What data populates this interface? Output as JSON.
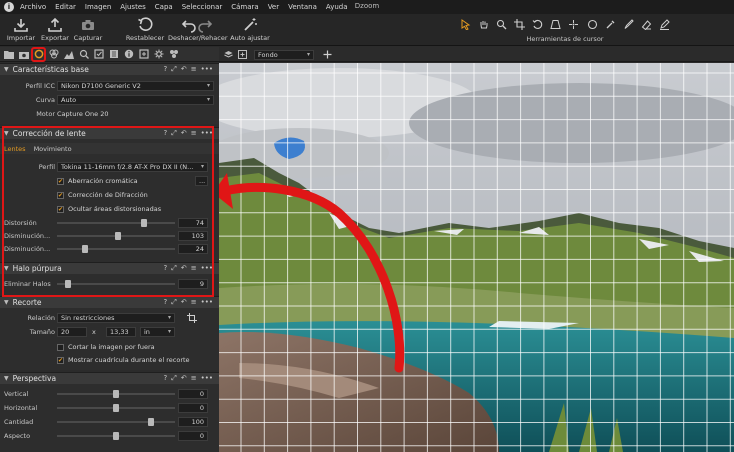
{
  "window": {
    "title": "Dzoom"
  },
  "menu": [
    "Archivo",
    "Editar",
    "Imagen",
    "Ajustes",
    "Capa",
    "Seleccionar",
    "Cámara",
    "Ver",
    "Ventana",
    "Ayuda"
  ],
  "toolbar": {
    "import": "Importar",
    "export": "Exportar",
    "capture": "Capturar",
    "reset": "Restablecer",
    "undo_redo": "Deshacer/Rehacer",
    "auto_adjust": "Auto ajustar",
    "cursor_tools": "Herramientas de cursor"
  },
  "viewer": {
    "layer": "Fondo"
  },
  "base_characteristics": {
    "title": "Características base",
    "icc_label": "Perfil ICC",
    "icc_value": "Nikon D7100 Generic V2",
    "curve_label": "Curva",
    "curve_value": "Auto",
    "engine_label": "Motor",
    "engine_value": "Capture One 20"
  },
  "lens_correction": {
    "title": "Corrección de lente",
    "tab_lenses": "Lentes",
    "tab_movement": "Movimiento",
    "profile_label": "Perfil",
    "profile_value": "Tokina 11-16mm f/2.8 AT-X Pro DX II (N...",
    "chromatic": "Aberración cromática",
    "chromatic_more": "...",
    "diffraction": "Corrección de Difracción",
    "hide_distorted": "Ocultar áreas distorsionadas",
    "distortion_label": "Distorsión",
    "distortion_value": "74",
    "distortion_level": 0.74,
    "falloff_label": "Disminución...",
    "falloff_value": "103",
    "falloff_level": 0.515,
    "sharpness_label": "Disminución...",
    "sharpness_value": "24",
    "sharpness_level": 0.24
  },
  "purple_fringe": {
    "title": "Halo púrpura",
    "remove_label": "Eliminar Halos",
    "remove_value": "9",
    "remove_level": 0.09
  },
  "crop": {
    "title": "Recorte",
    "ratio_label": "Relación",
    "ratio_value": "Sin restricciones",
    "size_label": "Tamaño",
    "width": "20",
    "times": "x",
    "height": "13,33",
    "unit": "in",
    "crop_outside": "Cortar la imagen por fuera",
    "show_grid": "Mostrar cuadrícula durante el recorte"
  },
  "perspective": {
    "title": "Perspectiva",
    "vertical_label": "Vertical",
    "vertical_value": "0",
    "horizontal_label": "Horizontal",
    "horizontal_value": "0",
    "amount_label": "Cantidad",
    "amount_value": "100",
    "aspect_label": "Aspecto",
    "aspect_value": "0"
  },
  "colors": {
    "accent": "#e49a20",
    "highlight": "#e01616"
  }
}
